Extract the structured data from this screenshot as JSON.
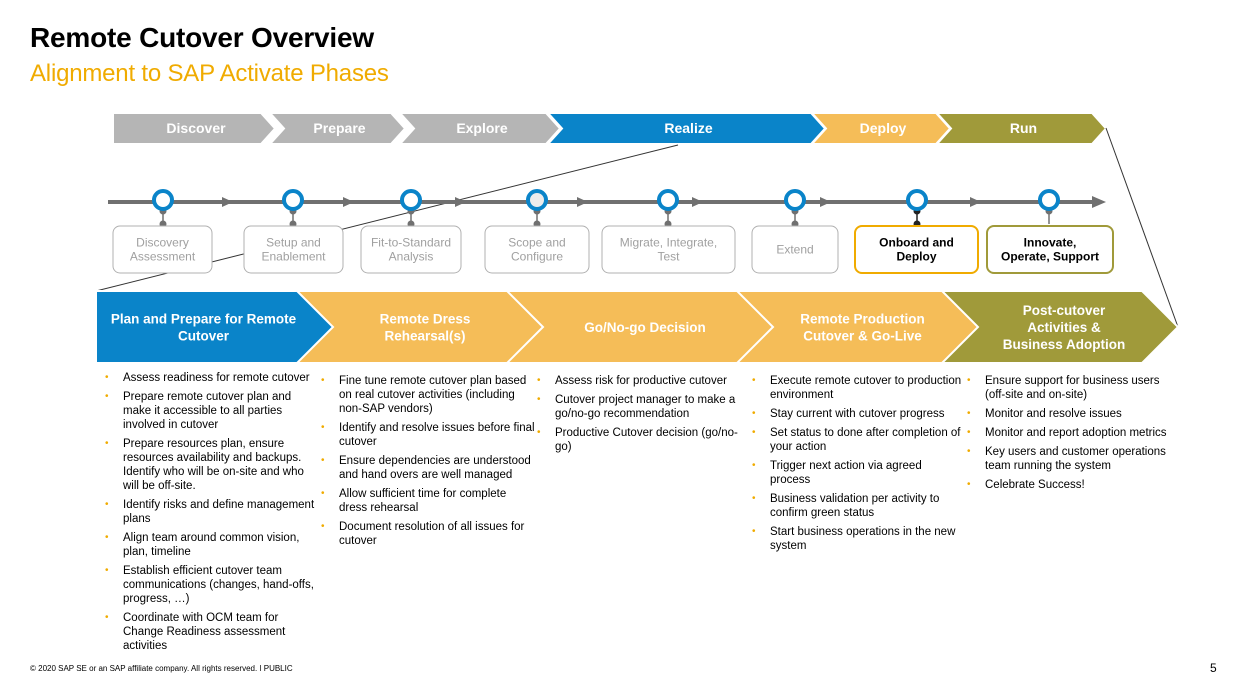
{
  "header": {
    "title": "Remote Cutover Overview",
    "subtitle": "Alignment to SAP Activate Phases"
  },
  "colors": {
    "gray": "#b5b5b5",
    "blue": "#0a84c9",
    "yellow": "#f5bd58",
    "olive": "#a09a3a",
    "accent_orange": "#f0ab00"
  },
  "activate_phases": [
    {
      "label": "Discover",
      "color": "gray"
    },
    {
      "label": "Prepare",
      "color": "gray"
    },
    {
      "label": "Explore",
      "color": "gray"
    },
    {
      "label": "Realize",
      "color": "blue"
    },
    {
      "label": "Deploy",
      "color": "yellow"
    },
    {
      "label": "Run",
      "color": "olive"
    }
  ],
  "timeline_steps": [
    {
      "lines": [
        "Discovery",
        "Assessment"
      ],
      "style": "gray"
    },
    {
      "lines": [
        "Setup and",
        "Enablement"
      ],
      "style": "gray"
    },
    {
      "lines": [
        "Fit-to-Standard",
        "Analysis"
      ],
      "style": "gray"
    },
    {
      "lines": [
        "Scope and",
        "Configure"
      ],
      "style": "gray"
    },
    {
      "lines": [
        "Migrate, Integrate,",
        "Test"
      ],
      "style": "gray"
    },
    {
      "lines": [
        "Extend"
      ],
      "style": "gray"
    },
    {
      "lines": [
        "Onboard and",
        "Deploy"
      ],
      "style": "deploy"
    },
    {
      "lines": [
        "Innovate,",
        "Operate, Support"
      ],
      "style": "run"
    }
  ],
  "cutover_phases": [
    {
      "lines": [
        "Plan and Prepare for Remote",
        "Cutover"
      ],
      "color": "blue",
      "bullets": [
        "Assess readiness for remote cutover",
        "Prepare remote cutover plan and make it accessible to all parties involved in cutover",
        "Prepare resources plan, ensure resources availability and backups. Identify who will be on-site and who will be off-site.",
        "Identify risks and define management plans",
        "Align team around common vision, plan, timeline",
        "Establish efficient cutover team communications (changes, hand-offs, progress, …)",
        "Coordinate with OCM team for Change Readiness assessment activities"
      ]
    },
    {
      "lines": [
        "Remote Dress",
        "Rehearsal(s)"
      ],
      "color": "yellow",
      "bullets": [
        "Fine tune remote cutover plan based on real cutover activities (including non-SAP vendors)",
        "Identify and resolve issues before final cutover",
        "Ensure dependencies are understood and hand overs are well managed",
        "Allow sufficient time for complete dress rehearsal",
        "Document resolution of all issues for cutover"
      ]
    },
    {
      "lines": [
        "Go/No-go Decision"
      ],
      "color": "yellow",
      "bullets": [
        "Assess risk for productive cutover",
        "Cutover project manager to make a go/no-go recommendation",
        "Productive Cutover decision (go/no-go)"
      ]
    },
    {
      "lines": [
        "Remote Production",
        "Cutover & Go-Live"
      ],
      "color": "yellow",
      "bullets": [
        "Execute remote cutover to production environment",
        "Stay current with cutover progress",
        "Set status to done after completion of your action",
        "Trigger next action via agreed process",
        "Business validation per activity to confirm green status",
        "Start business operations in the new system"
      ]
    },
    {
      "lines": [
        "Post-cutover",
        "Activities &",
        "Business Adoption"
      ],
      "color": "olive",
      "bullets": [
        "Ensure support for business users (off-site and on-site)",
        "Monitor and resolve issues",
        "Monitor and report adoption metrics",
        "Key users and customer operations team running the system",
        "Celebrate Success!"
      ]
    }
  ],
  "footer": {
    "copyright": "© 2020 SAP SE or an SAP affiliate company. All rights reserved.  ǀ  PUBLIC",
    "page_number": "5"
  }
}
